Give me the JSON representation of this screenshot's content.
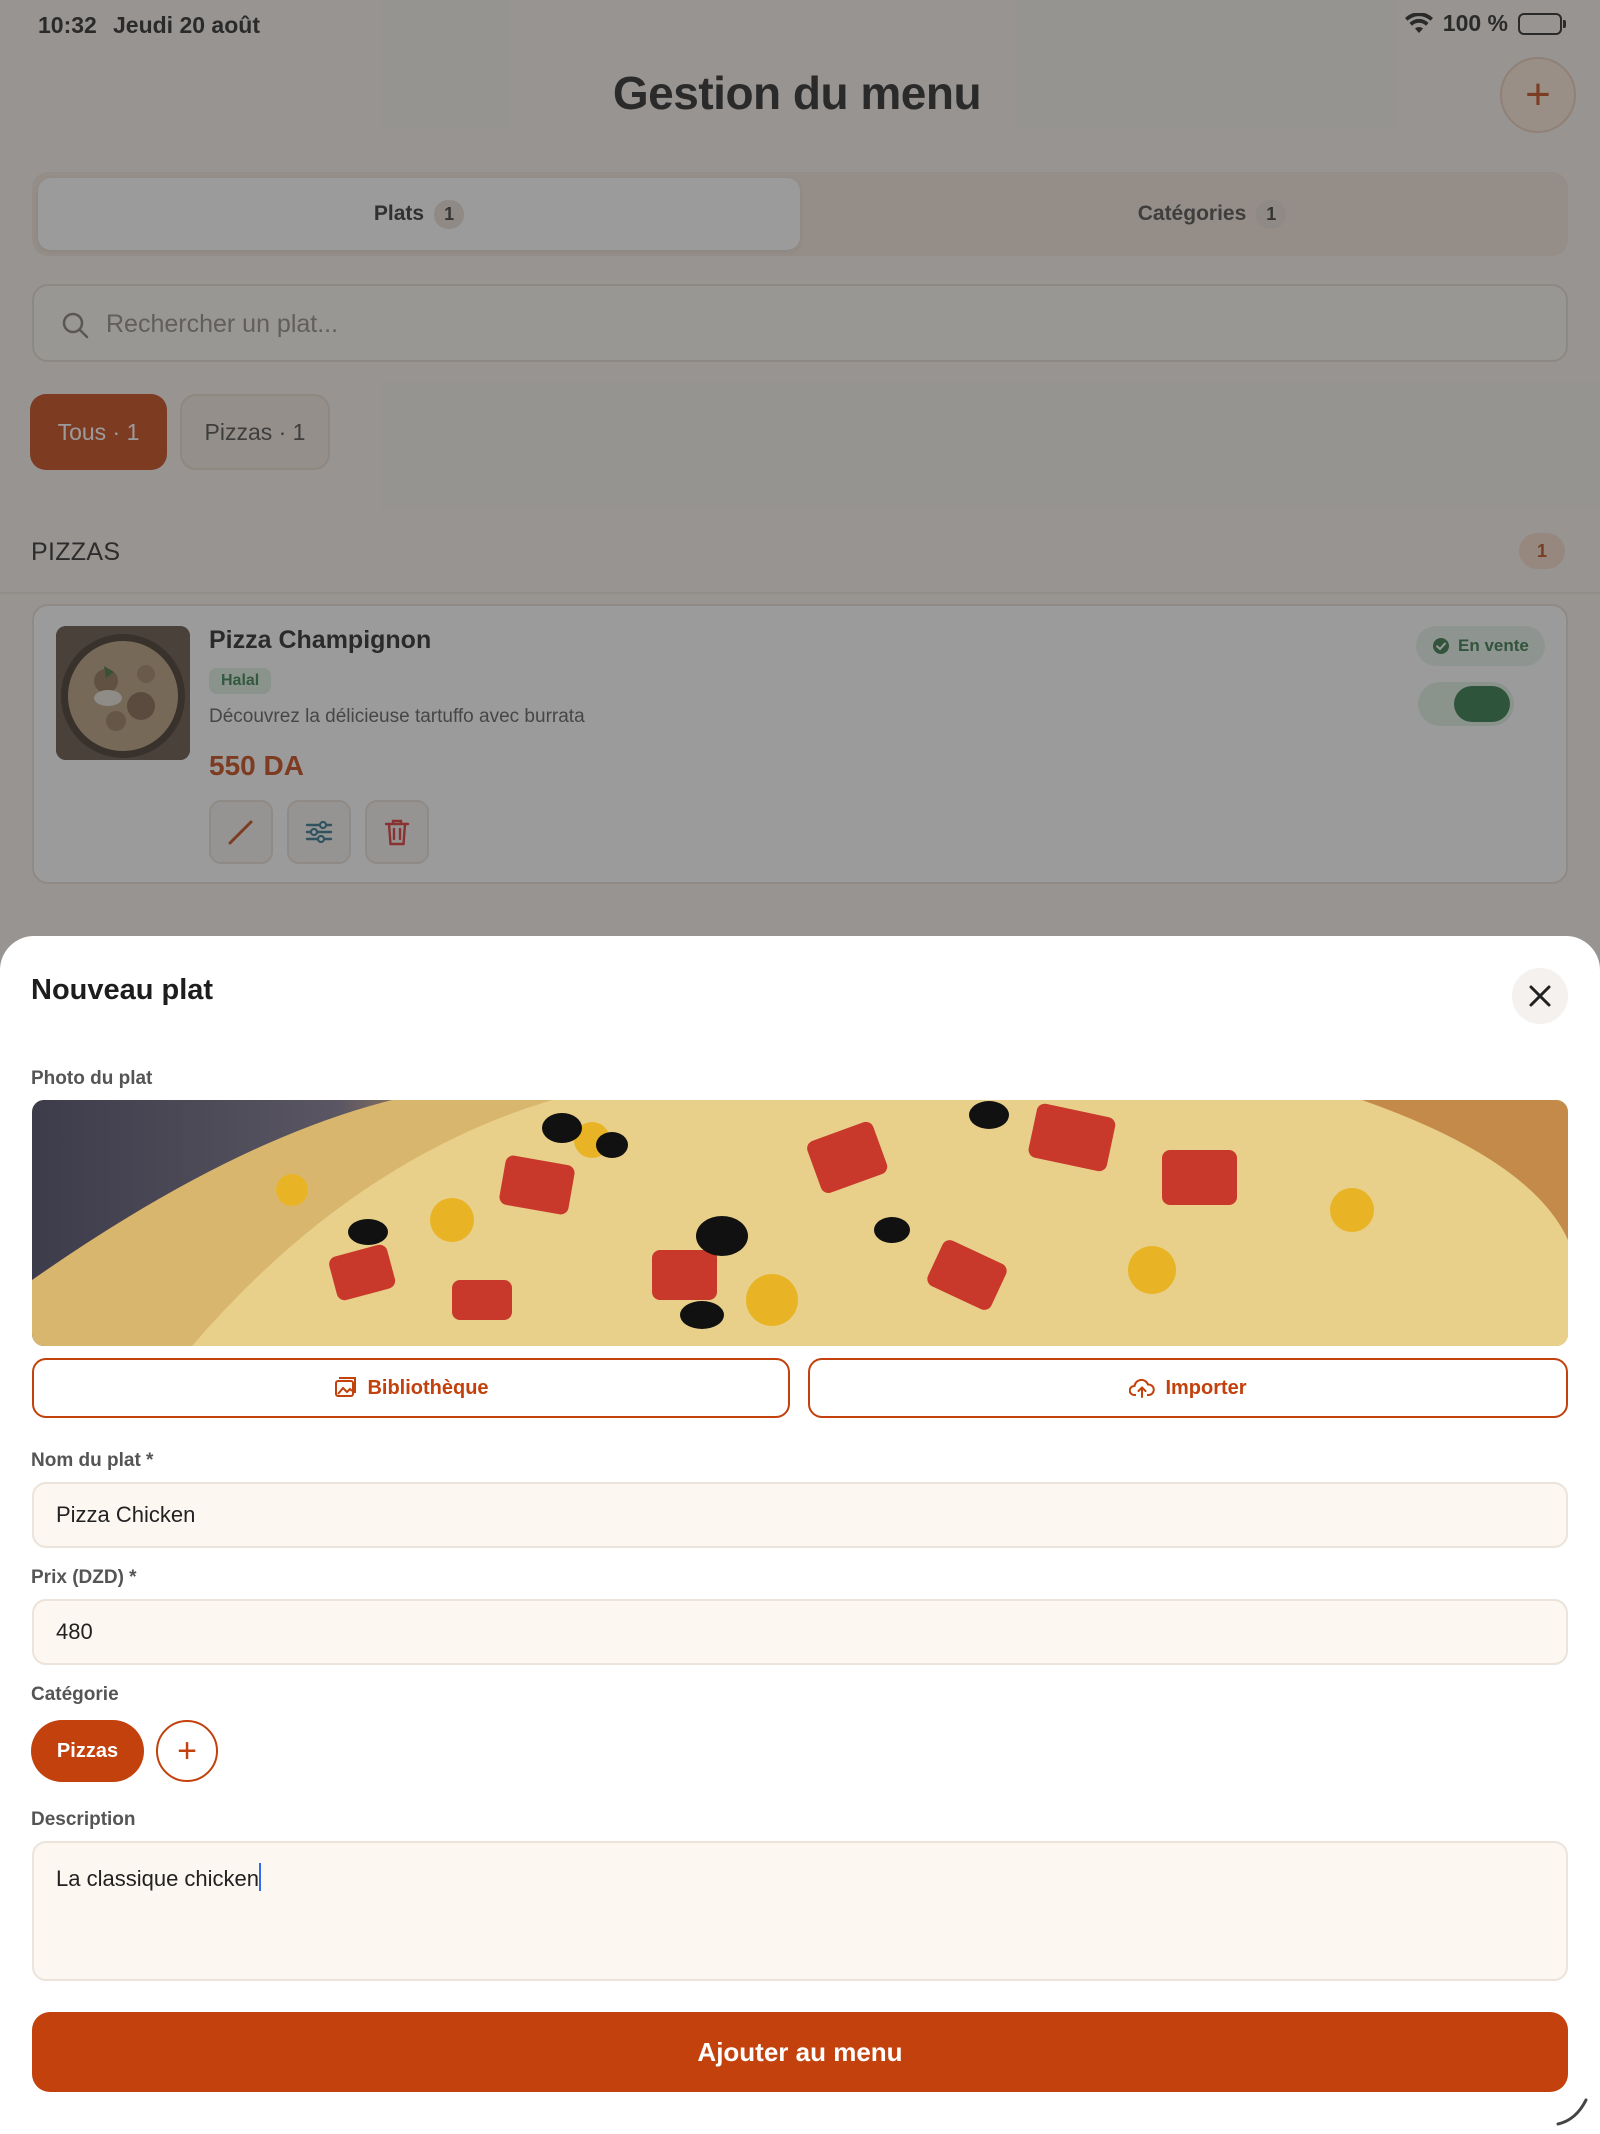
{
  "status_bar": {
    "time": "10:32",
    "date": "Jeudi 20 août",
    "battery": "100 %"
  },
  "header": {
    "title": "Gestion du menu",
    "add_icon": "plus-icon"
  },
  "tabs": [
    {
      "label": "Plats",
      "count": "1",
      "active": true
    },
    {
      "label": "Catégories",
      "count": "1",
      "active": false
    }
  ],
  "search": {
    "placeholder": "Rechercher un plat..."
  },
  "filters": [
    {
      "label": "Tous · 1",
      "active": true
    },
    {
      "label": "Pizzas · 1",
      "active": false
    }
  ],
  "section": {
    "title": "PIZZAS",
    "count": "1"
  },
  "dish_card": {
    "name": "Pizza Champignon",
    "tag": "Halal",
    "description": "Découvrez la délicieuse tartuffo avec burrata",
    "price": "550 DA",
    "status": "En vente",
    "on_sale": true,
    "actions": [
      "edit-icon",
      "options-sliders-icon",
      "trash-icon"
    ]
  },
  "sheet": {
    "title": "Nouveau plat",
    "photo_label": "Photo du plat",
    "library_button": "Bibliothèque",
    "import_button": "Importer",
    "name_label": "Nom du plat *",
    "name_value": "Pizza Chicken",
    "price_label": "Prix (DZD) *",
    "price_value": "480",
    "category_label": "Catégorie",
    "category_selected": "Pizzas",
    "description_label": "Description",
    "description_value": "La classique chicken",
    "submit_button": "Ajouter au menu"
  },
  "colors": {
    "accent": "#c2410c",
    "success": "#25733e"
  }
}
